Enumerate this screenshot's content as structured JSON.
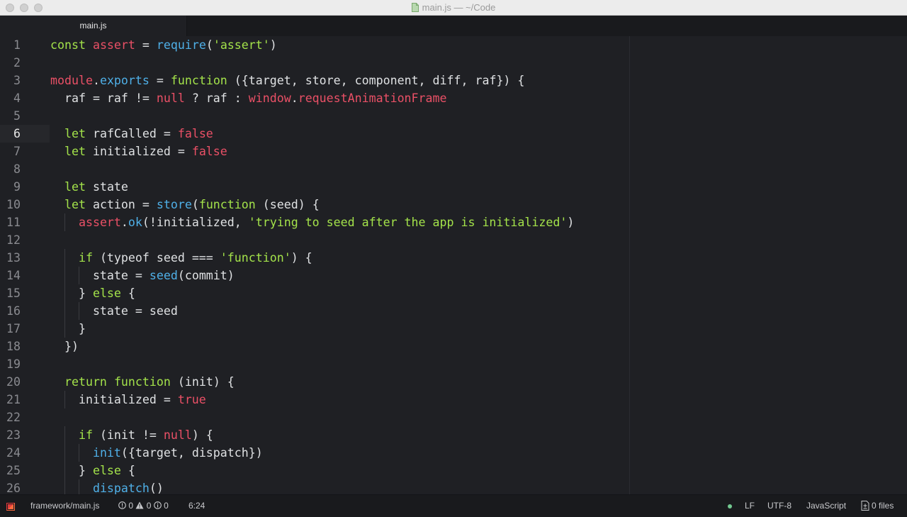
{
  "window": {
    "title": "main.js — ~/Code"
  },
  "tabs": [
    {
      "label": "main.js"
    }
  ],
  "editor": {
    "language": "JavaScript",
    "cursor_line": 6,
    "lines": [
      {
        "n": "1",
        "indent": 0,
        "tokens": [
          [
            "kw",
            "const"
          ],
          [
            "pl",
            " "
          ],
          [
            "var",
            "assert"
          ],
          [
            "pl",
            " = "
          ],
          [
            "fn",
            "require"
          ],
          [
            "pl",
            "("
          ],
          [
            "str",
            "'assert'"
          ],
          [
            "pl",
            ")"
          ]
        ]
      },
      {
        "n": "2",
        "indent": 0,
        "tokens": []
      },
      {
        "n": "3",
        "indent": 0,
        "tokens": [
          [
            "var",
            "module"
          ],
          [
            "pl",
            "."
          ],
          [
            "fn",
            "exports"
          ],
          [
            "pl",
            " = "
          ],
          [
            "kw",
            "function"
          ],
          [
            "pl",
            " ({target, store, component, diff, raf}) {"
          ]
        ]
      },
      {
        "n": "4",
        "indent": 1,
        "tokens": [
          [
            "pl",
            "  raf = raf != "
          ],
          [
            "lit",
            "null"
          ],
          [
            "pl",
            " ? raf : "
          ],
          [
            "var",
            "window"
          ],
          [
            "pl",
            "."
          ],
          [
            "var",
            "requestAnimationFrame"
          ]
        ]
      },
      {
        "n": "5",
        "indent": 0,
        "tokens": []
      },
      {
        "n": "6",
        "indent": 1,
        "tokens": [
          [
            "pl",
            "  "
          ],
          [
            "kw",
            "let"
          ],
          [
            "pl",
            " rafCalled = "
          ],
          [
            "lit",
            "false"
          ]
        ]
      },
      {
        "n": "7",
        "indent": 1,
        "tokens": [
          [
            "pl",
            "  "
          ],
          [
            "kw",
            "let"
          ],
          [
            "pl",
            " initialized = "
          ],
          [
            "lit",
            "false"
          ]
        ]
      },
      {
        "n": "8",
        "indent": 0,
        "tokens": []
      },
      {
        "n": "9",
        "indent": 1,
        "tokens": [
          [
            "pl",
            "  "
          ],
          [
            "kw",
            "let"
          ],
          [
            "pl",
            " state"
          ]
        ]
      },
      {
        "n": "10",
        "indent": 1,
        "tokens": [
          [
            "pl",
            "  "
          ],
          [
            "kw",
            "let"
          ],
          [
            "pl",
            " action = "
          ],
          [
            "fn",
            "store"
          ],
          [
            "pl",
            "("
          ],
          [
            "kw",
            "function"
          ],
          [
            "pl",
            " (seed) {"
          ]
        ]
      },
      {
        "n": "11",
        "indent": 2,
        "tokens": [
          [
            "pl",
            "    "
          ],
          [
            "var",
            "assert"
          ],
          [
            "pl",
            "."
          ],
          [
            "fn",
            "ok"
          ],
          [
            "pl",
            "(!initialized, "
          ],
          [
            "str",
            "'trying to seed after the app is initialized'"
          ],
          [
            "pl",
            ")"
          ]
        ]
      },
      {
        "n": "12",
        "indent": 0,
        "tokens": []
      },
      {
        "n": "13",
        "indent": 2,
        "tokens": [
          [
            "pl",
            "    "
          ],
          [
            "kw",
            "if"
          ],
          [
            "pl",
            " (typeof seed === "
          ],
          [
            "str",
            "'function'"
          ],
          [
            "pl",
            ") {"
          ]
        ]
      },
      {
        "n": "14",
        "indent": 3,
        "tokens": [
          [
            "pl",
            "      state = "
          ],
          [
            "fn",
            "seed"
          ],
          [
            "pl",
            "(commit)"
          ]
        ]
      },
      {
        "n": "15",
        "indent": 2,
        "tokens": [
          [
            "pl",
            "    } "
          ],
          [
            "kw",
            "else"
          ],
          [
            "pl",
            " {"
          ]
        ]
      },
      {
        "n": "16",
        "indent": 3,
        "tokens": [
          [
            "pl",
            "      state = seed"
          ]
        ]
      },
      {
        "n": "17",
        "indent": 2,
        "tokens": [
          [
            "pl",
            "    }"
          ]
        ]
      },
      {
        "n": "18",
        "indent": 1,
        "tokens": [
          [
            "pl",
            "  })"
          ]
        ]
      },
      {
        "n": "19",
        "indent": 0,
        "tokens": []
      },
      {
        "n": "20",
        "indent": 1,
        "tokens": [
          [
            "pl",
            "  "
          ],
          [
            "kw",
            "return"
          ],
          [
            "pl",
            " "
          ],
          [
            "kw",
            "function"
          ],
          [
            "pl",
            " (init) {"
          ]
        ]
      },
      {
        "n": "21",
        "indent": 2,
        "tokens": [
          [
            "pl",
            "    initialized = "
          ],
          [
            "lit",
            "true"
          ]
        ]
      },
      {
        "n": "22",
        "indent": 0,
        "tokens": []
      },
      {
        "n": "23",
        "indent": 2,
        "tokens": [
          [
            "pl",
            "    "
          ],
          [
            "kw",
            "if"
          ],
          [
            "pl",
            " (init != "
          ],
          [
            "lit",
            "null"
          ],
          [
            "pl",
            ") {"
          ]
        ]
      },
      {
        "n": "24",
        "indent": 3,
        "tokens": [
          [
            "pl",
            "      "
          ],
          [
            "fn",
            "init"
          ],
          [
            "pl",
            "({target, dispatch})"
          ]
        ]
      },
      {
        "n": "25",
        "indent": 2,
        "tokens": [
          [
            "pl",
            "    } "
          ],
          [
            "kw",
            "else"
          ],
          [
            "pl",
            " {"
          ]
        ]
      },
      {
        "n": "26",
        "indent": 3,
        "tokens": [
          [
            "pl",
            "      "
          ],
          [
            "fn",
            "dispatch"
          ],
          [
            "pl",
            "()"
          ]
        ]
      }
    ]
  },
  "statusbar": {
    "file_path": "framework/main.js",
    "errors": "0",
    "warnings": "0",
    "infos": "0",
    "cursor_position": "6:24",
    "line_ending": "LF",
    "encoding": "UTF-8",
    "grammar": "JavaScript",
    "changed_files": "0 files"
  }
}
